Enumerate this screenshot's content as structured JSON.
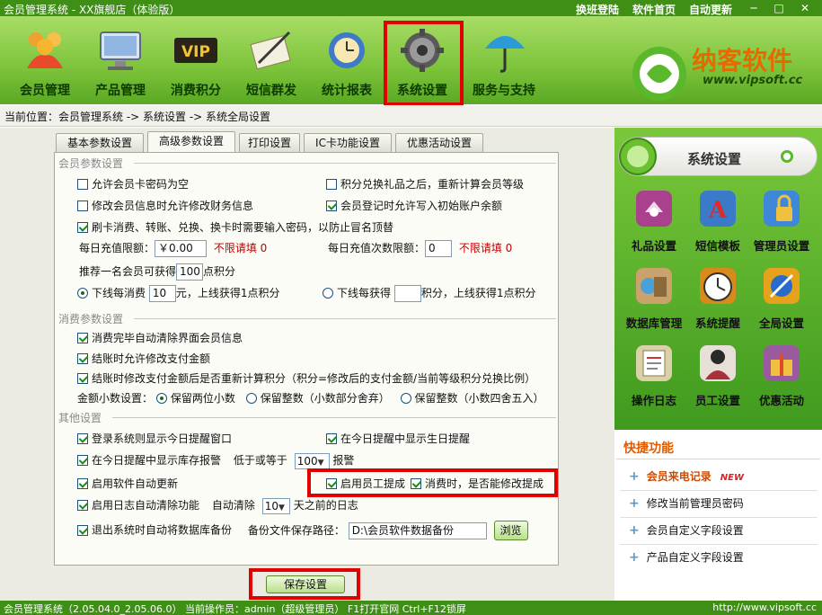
{
  "window": {
    "title": "会员管理系统 - XX旗舰店（体验版）",
    "links": [
      "换班登陆",
      "软件首页",
      "自动更新"
    ]
  },
  "nav": [
    {
      "label": "会员管理",
      "icon": "members-icon"
    },
    {
      "label": "产品管理",
      "icon": "monitor-icon"
    },
    {
      "label": "消费积分",
      "icon": "vip-icon"
    },
    {
      "label": "短信群发",
      "icon": "letter-pen-icon"
    },
    {
      "label": "统计报表",
      "icon": "clock-globe-icon"
    },
    {
      "label": "系统设置",
      "icon": "gear-icon"
    },
    {
      "label": "服务与支持",
      "icon": "umbrella-icon"
    }
  ],
  "logo": {
    "name": "纳客软件",
    "url": "www.vipsoft.cc"
  },
  "breadcrumb": "当前位置：会员管理系统 -> 系统设置 -> 系统全局设置",
  "tabs": [
    "基本参数设置",
    "高级参数设置",
    "打印设置",
    "IC卡功能设置",
    "优惠活动设置"
  ],
  "member": {
    "title": "会员参数设置",
    "opt1": "允许会员卡密码为空",
    "opt2": "积分兑换礼品之后，重新计算会员等级",
    "opt3": "修改会员信息时允许修改财务信息",
    "opt4": "会员登记时允许写入初始账户余额",
    "opt5": "刷卡消费、转账、兑换、换卡时需要输入密码，以防止冒名顶替",
    "daily_recharge_label": "每日充值限额：",
    "daily_recharge_value": "￥0.00",
    "no_limit_text": "不限请填 0",
    "daily_count_label": "每日充值次数限额：",
    "daily_count_value": "0",
    "recommend_prefix": "推荐一名会员可获得",
    "recommend_value": "100",
    "recommend_suffix": "点积分",
    "downline_consume_label": "下线每消费",
    "downline_consume_value": "10",
    "downline_consume_suffix": "元，上线获得1点积分",
    "downline_gain_label": "下线每获得",
    "downline_gain_value": "",
    "downline_gain_suffix": "积分，上线获得1点积分"
  },
  "consume": {
    "title": "消费参数设置",
    "opt1": "消费完毕自动清除界面会员信息",
    "opt2": "结账时允许修改支付金额",
    "opt3": "结账时修改支付金额后是否重新计算积分（积分=修改后的支付金额/当前等级积分兑换比例）",
    "decimal_label": "金额小数设置：",
    "decimal_opt1": "保留两位小数",
    "decimal_opt2": "保留整数（小数部分舍弃）",
    "decimal_opt3": "保留整数（小数四舍五入）"
  },
  "other": {
    "title": "其他设置",
    "opt1": "登录系统则显示今日提醒窗口",
    "opt2": "在今日提醒中显示生日提醒",
    "opt3": "在今日提醒中显示库存报警",
    "stock_le": "低于或等于",
    "stock_value": "100",
    "stock_suffix": "报警",
    "opt4": "启用软件自动更新",
    "opt5": "启用员工提成",
    "opt6": "消费时，是否能修改提成",
    "opt7": "启用日志自动清除功能",
    "log_clear": "自动清除",
    "log_value": "10",
    "log_suffix": "天之前的日志",
    "opt8": "退出系统时自动将数据库备份",
    "backup_label": "备份文件保存路径：",
    "backup_path": "D:\\会员软件数据备份",
    "browse": "浏览"
  },
  "save_button": "保存设置",
  "right": {
    "header": "系统设置",
    "items": [
      {
        "label": "礼品设置",
        "icon": "gift-icon",
        "color": "#a9418f"
      },
      {
        "label": "短信模板",
        "icon": "font-a-icon",
        "color": "#3a7ac8"
      },
      {
        "label": "管理员设置",
        "icon": "admin-lock-icon",
        "color": "#3f88d8"
      },
      {
        "label": "数据库管理",
        "icon": "database-box-icon",
        "color": "#c9a36b"
      },
      {
        "label": "系统提醒",
        "icon": "alarm-clock-icon",
        "color": "#d88a1a"
      },
      {
        "label": "全局设置",
        "icon": "global-tools-icon",
        "color": "#e5a21a"
      },
      {
        "label": "操作日志",
        "icon": "log-doc-icon",
        "color": "#d9d1a8"
      },
      {
        "label": "员工设置",
        "icon": "staff-icon",
        "color": "#a9323a"
      },
      {
        "label": "优惠活动",
        "icon": "promo-gift-icon",
        "color": "#9a5aa0"
      }
    ],
    "quick_title": "快捷功能",
    "quick": [
      {
        "label": "会员来电记录",
        "badge": "NEW"
      },
      {
        "label": "修改当前管理员密码"
      },
      {
        "label": "会员自定义字段设置"
      },
      {
        "label": "产品自定义字段设置"
      }
    ]
  },
  "status": {
    "left": "会员管理系统（2.05.04.0_2.05.06.0） 当前操作员：admin（超级管理员） F1打开官网 Ctrl+F12锁屏",
    "right": "http://www.vipsoft.cc"
  }
}
